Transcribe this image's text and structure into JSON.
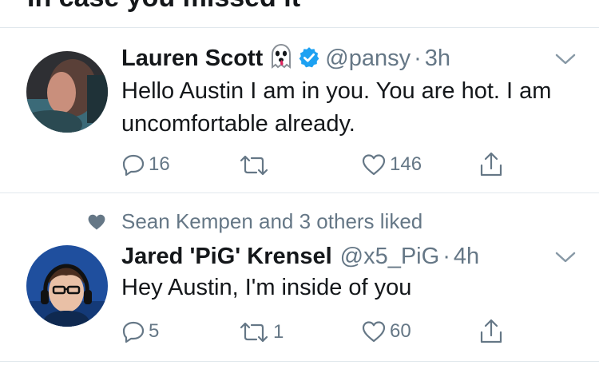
{
  "section": {
    "title": "In case you missed it"
  },
  "tweets": [
    {
      "name": "Lauren Scott",
      "emoji_icon": "ghost-icon",
      "verified": true,
      "handle": "@pansy",
      "dot": "·",
      "time": "3h",
      "text": "Hello Austin I am in you. You are hot. I am uncomfortable already.",
      "reply_count": "16",
      "retweet_count": "",
      "like_count": "146"
    },
    {
      "social_context": "Sean Kempen and 3 others liked",
      "name": "Jared 'PiG' Krensel",
      "verified": false,
      "handle": "@x5_PiG",
      "dot": "·",
      "time": "4h",
      "text": "Hey Austin, I'm inside of you",
      "reply_count": "5",
      "retweet_count": "1",
      "like_count": "60"
    }
  ],
  "colors": {
    "text": "#14171a",
    "secondary": "#657786",
    "verified_blue": "#1da1f2",
    "divider": "#e1e8ed"
  }
}
